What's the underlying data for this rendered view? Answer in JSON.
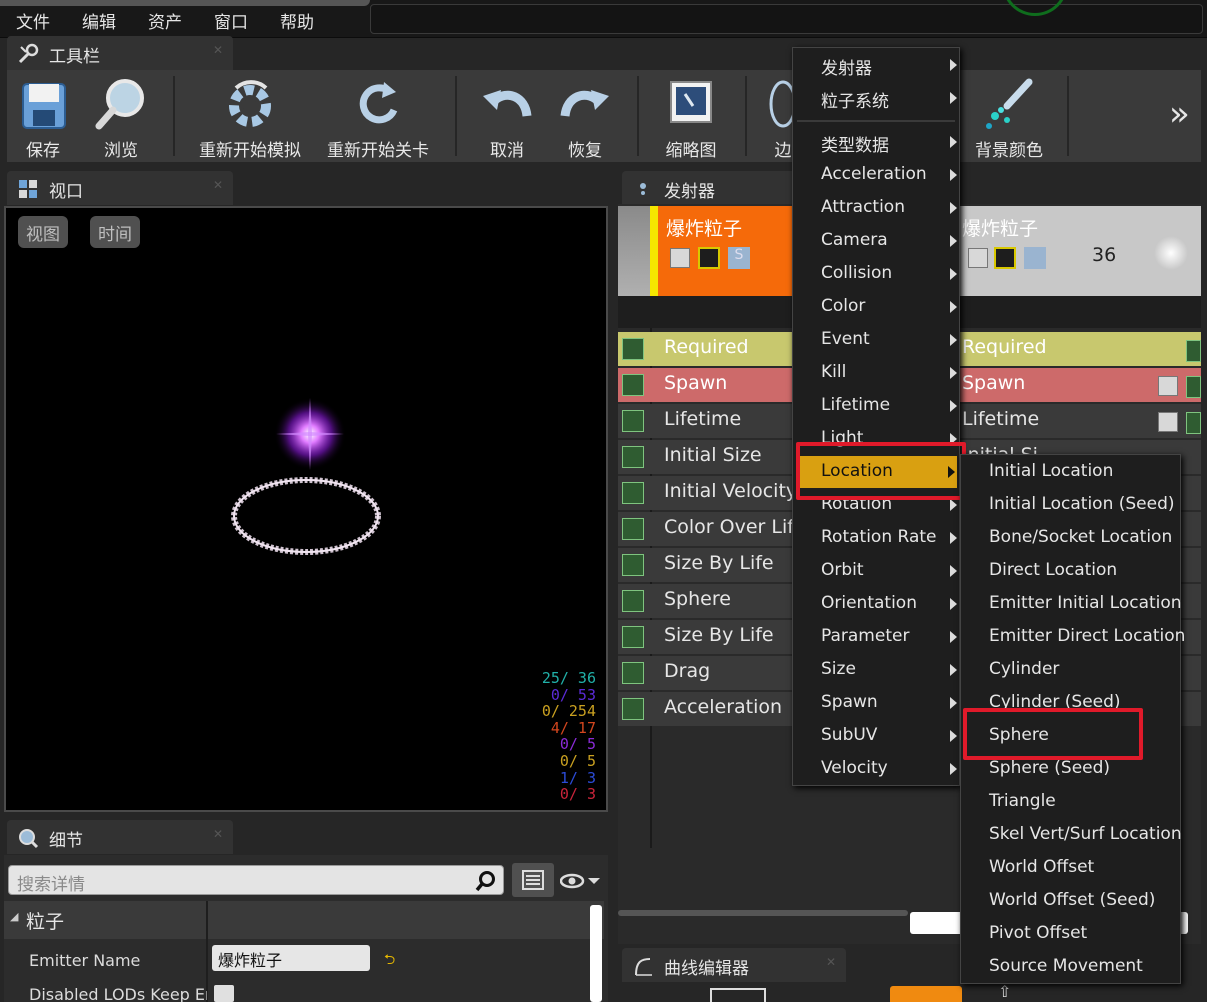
{
  "menubar": {
    "items": [
      {
        "label": "文件",
        "name": "menu-file"
      },
      {
        "label": "编辑",
        "name": "menu-edit"
      },
      {
        "label": "资产",
        "name": "menu-asset"
      },
      {
        "label": "窗口",
        "name": "menu-window"
      },
      {
        "label": "帮助",
        "name": "menu-help"
      }
    ]
  },
  "toolbar": {
    "tab_label": "工具栏",
    "buttons": [
      {
        "label": "保存",
        "icon": "save-icon"
      },
      {
        "label": "浏览",
        "icon": "browse-icon"
      },
      {
        "label": "重新开始模拟",
        "icon": "restart-sim-icon"
      },
      {
        "label": "重新开始关卡",
        "icon": "restart-level-icon"
      },
      {
        "label": "取消",
        "icon": "undo-icon"
      },
      {
        "label": "恢复",
        "icon": "redo-icon"
      },
      {
        "label": "缩略图",
        "icon": "thumbnail-icon"
      },
      {
        "label": "边",
        "icon": "bounds-icon"
      },
      {
        "label": "背景颜色",
        "icon": "background-color-icon"
      }
    ],
    "overflow": "»"
  },
  "viewport": {
    "tab_label": "视口",
    "view_button": "视图",
    "time_button": "时间",
    "stats": [
      {
        "text": "25/  36",
        "color": "#21b0a8"
      },
      {
        "text": "0/  53",
        "color": "#5b2bd6"
      },
      {
        "text": "0/ 254",
        "color": "#c9a020"
      },
      {
        "text": "4/  17",
        "color": "#d2461e"
      },
      {
        "text": "0/   5",
        "color": "#8a2bd6"
      },
      {
        "text": "0/   5",
        "color": "#c9a020"
      },
      {
        "text": "1/   3",
        "color": "#2b4bd6"
      },
      {
        "text": "0/   3",
        "color": "#c8243a"
      }
    ]
  },
  "details": {
    "tab_label": "细节",
    "search_placeholder": "搜索详情",
    "section": "粒子",
    "props": [
      {
        "label": "Emitter Name",
        "value": "爆炸粒子"
      },
      {
        "label": "Disabled LODs Keep Emit",
        "value": ""
      }
    ]
  },
  "emitters": {
    "tab_label": "发射器",
    "emitter1": {
      "name": "爆炸粒子"
    },
    "emitter2": {
      "name": "爆炸粒子",
      "count": "36"
    },
    "modules": [
      {
        "label": "Required",
        "bg": "#c8c86e",
        "fg": "#1d1d1d"
      },
      {
        "label": "Spawn",
        "bg": "#cd6a6a",
        "fg": "#ffffff"
      },
      {
        "label": "Lifetime",
        "bg": "#3a3a3a",
        "fg": "#e6e6e6"
      },
      {
        "label": "Initial Size",
        "bg": "#3a3a3a",
        "fg": "#e6e6e6"
      },
      {
        "label": "Initial Velocity",
        "bg": "#3a3a3a",
        "fg": "#e6e6e6"
      },
      {
        "label": "Color Over Life",
        "bg": "#3a3a3a",
        "fg": "#e6e6e6"
      },
      {
        "label": "Size By Life",
        "bg": "#3a3a3a",
        "fg": "#e6e6e6"
      },
      {
        "label": "Sphere",
        "bg": "#3a3a3a",
        "fg": "#e6e6e6"
      },
      {
        "label": "Size By Life",
        "bg": "#3a3a3a",
        "fg": "#e6e6e6"
      },
      {
        "label": "Drag",
        "bg": "#3a3a3a",
        "fg": "#e6e6e6"
      },
      {
        "label": "Acceleration",
        "bg": "#3a3a3a",
        "fg": "#e6e6e6"
      }
    ],
    "col2_modules": [
      "Required",
      "Spawn",
      "Lifetime",
      "Initial Si"
    ]
  },
  "context_menu": {
    "items": [
      "发射器",
      "粒子系统",
      "类型数据",
      "Acceleration",
      "Attraction",
      "Camera",
      "Collision",
      "Color",
      "Event",
      "Kill",
      "Lifetime",
      "Light",
      "Location",
      "Rotation",
      "Rotation Rate",
      "Orbit",
      "Orientation",
      "Parameter",
      "Size",
      "Spawn",
      "SubUV",
      "Velocity"
    ],
    "highlighted": "Location"
  },
  "submenu": {
    "items": [
      "Initial Location",
      "Initial Location (Seed)",
      "Bone/Socket Location",
      "Direct Location",
      "Emitter Initial Location",
      "Emitter Direct Location",
      "Cylinder",
      "Cylinder (Seed)",
      "Sphere",
      "Sphere (Seed)",
      "Triangle",
      "Skel Vert/Surf Location",
      "World Offset",
      "World Offset (Seed)",
      "Pivot Offset",
      "Source Movement"
    ],
    "highlighted": "Sphere"
  },
  "curve_editor": {
    "tab_label": "曲线编辑器"
  },
  "colors": {
    "highlight": "#d9a011",
    "emitter_orange": "#f56a0a",
    "red_box": "#e01a2a"
  }
}
